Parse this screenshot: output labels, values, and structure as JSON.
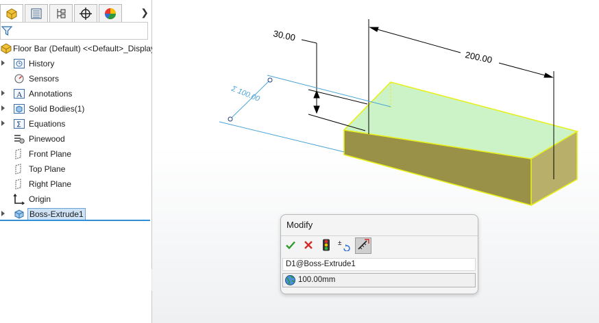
{
  "window": {
    "width_note": ""
  },
  "tabs": [
    {
      "name": "feature-manager-tab",
      "icon": "feature-manager-icon"
    },
    {
      "name": "property-manager-tab",
      "icon": "property-list-icon"
    },
    {
      "name": "configuration-manager-tab",
      "icon": "configuration-icon"
    },
    {
      "name": "dimxpert-manager-tab",
      "icon": "crosshair-icon"
    },
    {
      "name": "display-manager-tab",
      "icon": "pie-chart-icon"
    }
  ],
  "tree": {
    "root": "Floor Bar (Default) <<Default>_Display",
    "items": [
      {
        "label": "History",
        "icon": "history-icon",
        "expandable": true
      },
      {
        "label": "Sensors",
        "icon": "sensor-icon",
        "expandable": false
      },
      {
        "label": "Annotations",
        "icon": "annotation-icon",
        "expandable": true
      },
      {
        "label": "Solid Bodies(1)",
        "icon": "solid-body-folder-icon",
        "expandable": true
      },
      {
        "label": "Equations",
        "icon": "equations-icon",
        "expandable": true
      },
      {
        "label": "Pinewood",
        "icon": "material-icon",
        "expandable": false
      },
      {
        "label": "Front Plane",
        "icon": "plane-icon",
        "expandable": false
      },
      {
        "label": "Top Plane",
        "icon": "plane-icon",
        "expandable": false
      },
      {
        "label": "Right Plane",
        "icon": "plane-icon",
        "expandable": false
      },
      {
        "label": "Origin",
        "icon": "origin-icon",
        "expandable": false
      },
      {
        "label": "Boss-Extrude1",
        "icon": "extrude-feature-icon",
        "expandable": true,
        "selected": true
      }
    ]
  },
  "viewport": {
    "dimensions": [
      {
        "name": "height-dimension",
        "text": "30.00"
      },
      {
        "name": "length-dimension",
        "text": "200.00"
      },
      {
        "name": "depth-dimension",
        "text": "Σ 100.00"
      }
    ],
    "colors": {
      "top_face": "#c9f2c4",
      "front_face": "#9a9148",
      "side_face": "#b8b06a",
      "edge_highlight": "#e8f01a",
      "dimension_line": "#000000",
      "driven_dimension": "#4aa3d8"
    }
  },
  "modify_dialog": {
    "title": "Modify",
    "buttons": [
      {
        "name": "ok-button",
        "icon": "check-icon"
      },
      {
        "name": "cancel-button",
        "icon": "x-icon"
      },
      {
        "name": "rebuild-button",
        "icon": "traffic-light-icon"
      },
      {
        "name": "spin-increment-button",
        "icon": "plus-minus-icon"
      },
      {
        "name": "mark-for-drawing-button",
        "icon": "mark-dimension-icon",
        "pressed": true
      }
    ],
    "dimension_name": "D1@Boss-Extrude1",
    "value": "100.00mm",
    "scope_icon": "globe-icon"
  }
}
